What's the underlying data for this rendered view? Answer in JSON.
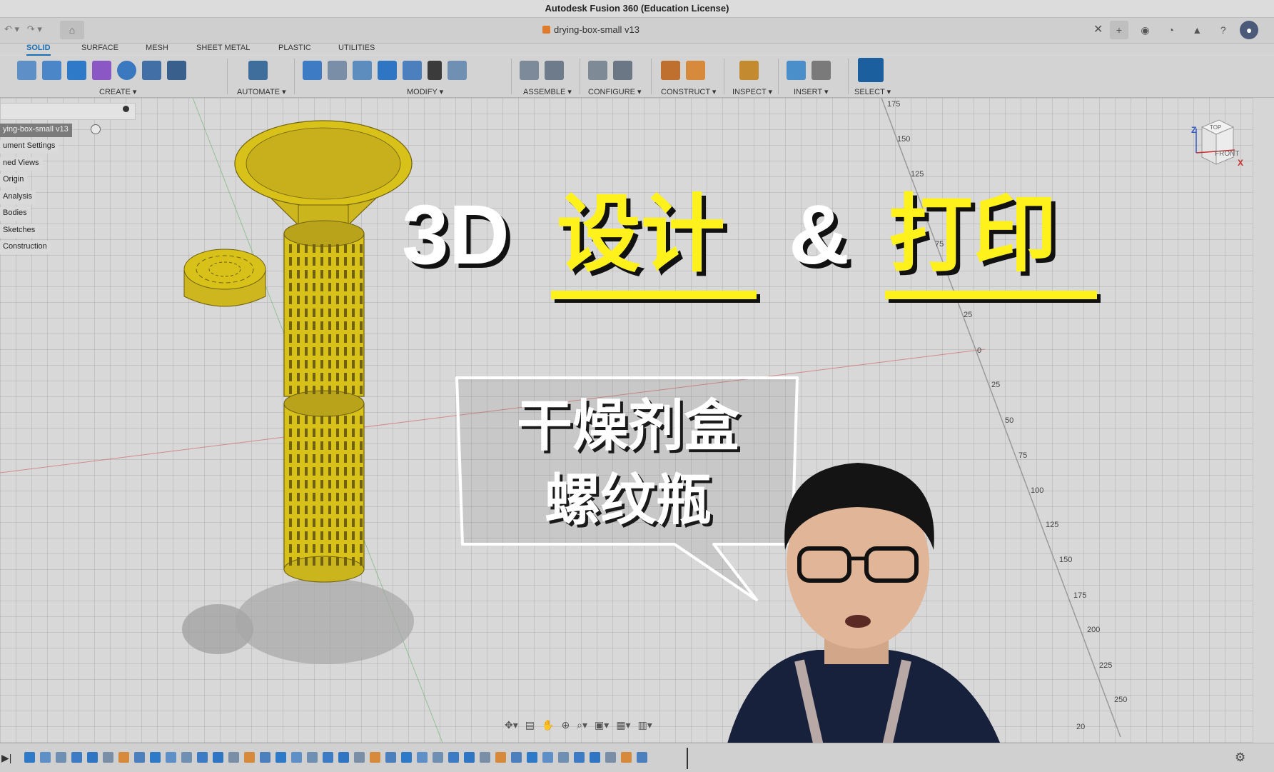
{
  "window": {
    "title": "Autodesk Fusion 360 (Education License)"
  },
  "document": {
    "tab_name": "drying-box-small v13",
    "close": "✕"
  },
  "workspace_tabs": [
    "SOLID",
    "SURFACE",
    "MESH",
    "SHEET METAL",
    "PLASTIC",
    "UTILITIES"
  ],
  "ribbon_groups": [
    "CREATE ▾",
    "AUTOMATE ▾",
    "MODIFY ▾",
    "ASSEMBLE ▾",
    "CONFIGURE ▾",
    "CONSTRUCT ▾",
    "INSPECT ▾",
    "INSERT ▾",
    "SELECT ▾"
  ],
  "browser": {
    "root": "ying-box-small v13",
    "items": [
      "ument Settings",
      "ned Views",
      "Origin",
      "Analysis",
      "Bodies",
      "Sketches",
      "Construction"
    ]
  },
  "ruler_labels": [
    "175",
    "150",
    "125",
    "75",
    "25",
    "0",
    "25",
    "50",
    "75",
    "100",
    "125",
    "150",
    "175",
    "200",
    "225",
    "250",
    "20"
  ],
  "viewcube": {
    "axis_z": "Z",
    "top": "TOP",
    "front": "FRONT",
    "axis_x": "X"
  },
  "overlay": {
    "line1_white_a": "3D",
    "line1_yellow_a": "设计",
    "line1_white_b": "&",
    "line1_yellow_b": "打印",
    "bubble_line1": "干燥剂盒",
    "bubble_line2": "螺纹瓶"
  },
  "colors": {
    "accent_blue": "#1a6fb5",
    "model_yellow": "#d8c21a",
    "title_yellow": "#fff21c"
  }
}
